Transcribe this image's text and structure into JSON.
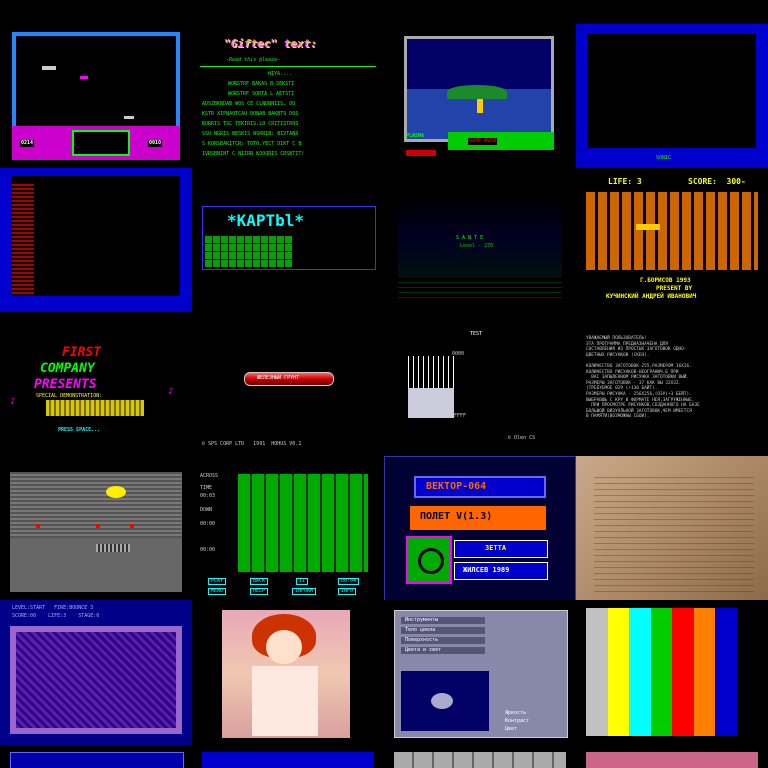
{
  "grid": {
    "cols": 4,
    "rows": 5
  },
  "colors": {
    "blue": "#0000cc",
    "green": "#00cc00",
    "red": "#cc0000",
    "yellow": "#ffff00",
    "cyan": "#00ffff",
    "magenta": "#ff00ff",
    "white": "#ffffff",
    "orange": "#ff8000"
  },
  "tiles": {
    "r0c0": {
      "title": "",
      "score_left": "0214",
      "score_right": "0010"
    },
    "r0c1": {
      "title": "\"Giftec\" text:",
      "subtitle": "-Read this please-",
      "lines": [
        "HIYA....",
        "WORSTRF BAKAS B SEKSTI",
        "WORSTRF SORTA L AETSTI",
        "ADSZBKNDAB WOS CE CLNUNNIIS. OU",
        "KSTR XIPNAQTCAU DONAB BAKBTS DOS",
        "BORRIS TSC TEKIRIS.LO CRITISTROS",
        "SSU NGRIS BESKIS NSKRIB: BIVTANS",
        "S KORSBAKITCR: TOTO.YECT DIKT C B",
        "IVRSBNINT C NIIRR KOOQRIS CRSBTIT!"
      ]
    },
    "r0c2": {
      "label": "PLASMA",
      "status": "GAME OVER"
    },
    "r0c3": {
      "caption": "SONIC"
    },
    "r1c0": {},
    "r1c1": {
      "title": "*KAPTbl*"
    },
    "r1c2": {
      "caption": "S A N T E",
      "sub": "Level - 270"
    },
    "r1c3": {
      "life": "LIFE: 3",
      "score": "SCORE:  300-",
      "credit1": "Г.БОРИСОВ 1993",
      "credit2": "PRESENT BY",
      "credit3": "КУЧИНСКИЙ АНДРЕЙ ИВАНОВИЧ"
    },
    "r2c0": {
      "l1": "FIRST",
      "l2": "COMPANY",
      "l3": "PRESENTS",
      "l4": "SPECIAL DEMONSTRATION:",
      "press": "PRESS SPACE..."
    },
    "r2c1": {
      "bar": "ЖЕЛЕЗНЫЙ ГРУНТ",
      "footer": "© SPS CORP LTD   1991  HOHUS V0.1"
    },
    "r2c2": {
      "top": "TEST",
      "mark1": "0000",
      "mark2": "FFFF",
      "copy": "© Olen CS"
    },
    "r2c3": {
      "lines": [
        "УВАЖАЕМЫЙ ПОЛЬЗОВАТЕЛЬ!",
        "ЭТА ПРОГРАММА ПРЕДНАЗНАЧЕНА ДЛЯ",
        "СОСТАВЛЕНИЯ ИЗ ПРОСТЫХ ЗАГОТОВОК ОДНО-",
        "ЦВЕТНЫХ РИСУНКОВ (СКЕН).",
        "",
        "КОЛИЧЕСТВО ЗАГОТОВОК-255,РАЗМЕРОМ 16Х16.",
        "КОЛИЧЕСТВО РИСУНКОВ-НЕОГРАНИЧ.Б ПРИ",
        "  ВАС ЗАПЫЛЕННОМ РИСУНКА ЗАГОТОВКИ ВЫЙ.",
        "РАЗМЕРЫ ЗАГОТОВОК - 37 КАК ВЫ 32Х32.",
        "(ТРЕБУЕМОЕ 029 (+130 БАЙТ).",
        "РАЗМЕРЫ РИСУНКА - 256Х256,(ОЗУ)+3 БЕЙТ).",
        "ВЫБРАВШЬ С КРУ В ФОРМАТЕ НЕЯ,ЗАГРУЖЕННЫЕ,",
        "  ПРИ ПРОСМОТРЕ РИСУНКОВ,СОЗДАННОГО НА БАЗЕ",
        "БОЛЬШОЙ ВИЗУАЛЬНОЙ ЗАГОТОВОК,ЧЕМ ИМЕЕТСЯ",
        "В ПАМЯТИ(ВОЗМОЖНЫ СБОИ)."
      ]
    },
    "r3c0": {},
    "r3c1": {
      "across": "ACROSS",
      "down": "DOWN",
      "time": "TIME",
      "val1": "00:03",
      "val2": "00:00",
      "val3": "00:00",
      "btns": [
        "PLAY",
        "BACK",
        "II",
        "00:04",
        "MENU",
        "HELP",
        "INFORM",
        "INFO"
      ]
    },
    "r3c2": {
      "t1": "ВЕКТОР-064",
      "t2": "ПОЛЕТ V(1.3)",
      "t3": "ЗЕТТА",
      "t4": "ЖИЛСЕВ 1989"
    },
    "r3c3": {},
    "r4c0": {
      "hud1": "LEVEL:START   FIRE:BOUNCE 3",
      "hud2": "SCORE:00    LIFE:3    STAGE:0"
    },
    "r4c1": {},
    "r4c2": {
      "menu": [
        "Инструменты",
        "Тело цикла",
        "Поверхность",
        "Цвета и свет"
      ],
      "labels": [
        "Яркость",
        "Контраст",
        "Цвет"
      ]
    },
    "r4c3": {
      "bars": [
        "#c0c0c0",
        "#ffff00",
        "#00ffff",
        "#00cc00",
        "#ff0000",
        "#ff8000",
        "#0000cc",
        "#000000"
      ]
    },
    "r5c0": {},
    "r5c1": {},
    "r5c2": {},
    "r5c3": {}
  }
}
